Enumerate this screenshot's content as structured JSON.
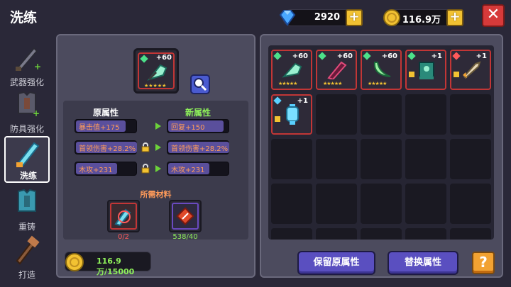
{
  "title": "洗练",
  "currency": {
    "diamonds": "2920",
    "gold": "116.9万"
  },
  "sidebar": {
    "items": [
      {
        "label": "武器强化",
        "icon": "sword-upgrade-icon"
      },
      {
        "label": "防具强化",
        "icon": "armor-upgrade-icon"
      },
      {
        "label": "洗练",
        "icon": "refine-sword-icon"
      },
      {
        "label": "重铸",
        "icon": "reforge-armor-icon"
      },
      {
        "label": "打造",
        "icon": "craft-hammer-icon"
      }
    ]
  },
  "selected_item": {
    "level": "+60",
    "icon": "jade-axe-icon",
    "stars": "★★★★★"
  },
  "attributes": {
    "original_header": "原属性",
    "new_header": "新属性",
    "original": [
      "暴击值+175",
      "首领伤害+28.2%",
      "木攻+231"
    ],
    "new": [
      "回复+150",
      "首领伤害+28.2%",
      "木攻+231"
    ],
    "materials_title": "所需材料",
    "materials": [
      {
        "count": "0/2",
        "color": "#ff5a5a",
        "icon": "refine-stone-icon"
      },
      {
        "count": "538/40",
        "color": "#8ef05a",
        "icon": "red-crystal-icon"
      }
    ]
  },
  "gold_cost": "116.9万/15000",
  "inventory": {
    "items": [
      {
        "level": "+60",
        "icon": "jade-axe-icon",
        "gem": "#4ce08a"
      },
      {
        "level": "+60",
        "icon": "dark-blade-icon",
        "gem": "#4ce08a"
      },
      {
        "level": "+60",
        "icon": "curved-sword-icon",
        "gem": "#4ce08a"
      },
      {
        "level": "+1",
        "icon": "banner-icon",
        "gem": "#4ce08a"
      },
      {
        "level": "+1",
        "icon": "rocket-icon",
        "gem": "#ff5a5a"
      },
      {
        "level": "+1",
        "icon": "lantern-icon",
        "gem": "#5ad0ff"
      }
    ]
  },
  "buttons": {
    "keep": "保留原属性",
    "replace": "替换属性",
    "help": "?"
  },
  "colors": {
    "accent": "#5a4fc0",
    "frame": "#c23636",
    "gold": "#f2c232"
  }
}
